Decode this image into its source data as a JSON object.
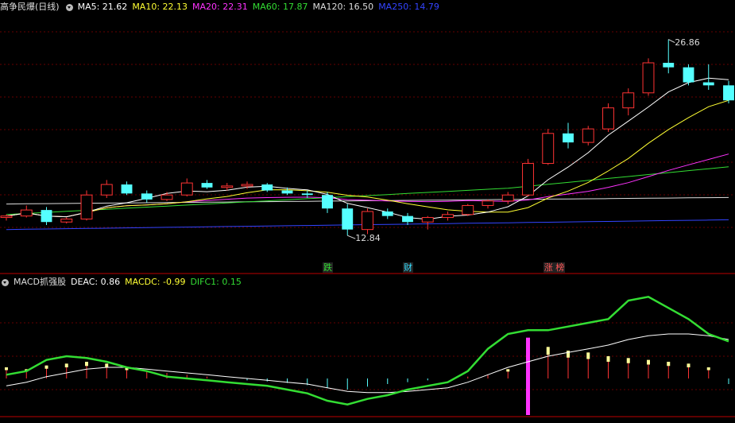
{
  "main_legend": {
    "title": "高争民爆(日线)",
    "items": [
      {
        "text": "MA5: 21.62",
        "color": "#ffffff"
      },
      {
        "text": "MA10: 22.13",
        "color": "#ffff33"
      },
      {
        "text": "MA20: 22.31",
        "color": "#ff33ff"
      },
      {
        "text": "MA60: 17.87",
        "color": "#33dd33"
      },
      {
        "text": "MA120: 16.50",
        "color": "#dddddd"
      },
      {
        "text": "MA250: 14.79",
        "color": "#3344ff"
      }
    ]
  },
  "sub_legend": {
    "title": "MACD抓强股",
    "items": [
      {
        "text": "DEAC: 0.86",
        "color": "#ffffff"
      },
      {
        "text": "MACDC: -0.99",
        "color": "#ffff33"
      },
      {
        "text": "DIFC1: 0.15",
        "color": "#33dd33"
      }
    ]
  },
  "annotations": {
    "high": "26.86",
    "low": "12.84"
  },
  "tags": [
    {
      "text": "跌",
      "color": "#33dd33",
      "index": 16
    },
    {
      "text": "财",
      "color": "#33ddff",
      "index": 20
    },
    {
      "text": "涨 榜",
      "color": "#ff5555",
      "index": 27
    }
  ],
  "colors": {
    "up": "#ff3333",
    "down": "#55ffff",
    "grid": "#660000",
    "border": "#bb0000"
  },
  "chart_data": {
    "type": "candlestick",
    "price_range": [
      11.8,
      28.0
    ],
    "candles": [
      [
        15.0,
        15.2,
        14.8,
        15.1
      ],
      [
        15.1,
        15.8,
        15.0,
        15.5
      ],
      [
        15.5,
        15.7,
        14.5,
        14.7
      ],
      [
        14.7,
        15.0,
        14.6,
        14.9
      ],
      [
        14.9,
        16.8,
        14.8,
        16.5
      ],
      [
        16.5,
        17.5,
        16.3,
        17.2
      ],
      [
        17.2,
        17.4,
        16.5,
        16.6
      ],
      [
        16.6,
        16.8,
        16.0,
        16.2
      ],
      [
        16.2,
        16.7,
        16.1,
        16.5
      ],
      [
        16.5,
        17.6,
        16.4,
        17.3
      ],
      [
        17.3,
        17.5,
        16.9,
        17.0
      ],
      [
        17.0,
        17.3,
        16.8,
        17.1
      ],
      [
        17.1,
        17.4,
        16.9,
        17.2
      ],
      [
        17.2,
        17.3,
        16.7,
        16.8
      ],
      [
        16.8,
        17.0,
        16.5,
        16.6
      ],
      [
        16.6,
        16.8,
        16.3,
        16.5
      ],
      [
        16.5,
        16.7,
        15.3,
        15.6
      ],
      [
        15.6,
        15.9,
        13.8,
        14.2
      ],
      [
        14.2,
        15.6,
        13.9,
        15.4
      ],
      [
        15.4,
        15.6,
        14.9,
        15.1
      ],
      [
        15.1,
        15.3,
        14.5,
        14.7
      ],
      [
        14.7,
        15.1,
        14.2,
        15.0
      ],
      [
        15.0,
        15.4,
        14.8,
        15.2
      ],
      [
        15.2,
        15.9,
        15.1,
        15.8
      ],
      [
        15.8,
        16.2,
        15.6,
        16.1
      ],
      [
        16.1,
        16.7,
        15.9,
        16.5
      ],
      [
        16.5,
        18.9,
        16.4,
        18.6
      ],
      [
        18.6,
        20.9,
        18.5,
        20.6
      ],
      [
        20.6,
        21.3,
        19.6,
        20.0
      ],
      [
        20.0,
        21.1,
        19.8,
        20.9
      ],
      [
        20.9,
        22.6,
        20.7,
        22.3
      ],
      [
        22.3,
        23.6,
        21.8,
        23.3
      ],
      [
        23.3,
        25.6,
        23.1,
        25.3
      ],
      [
        25.3,
        26.86,
        24.6,
        25.0
      ],
      [
        25.0,
        25.2,
        23.8,
        24.0
      ],
      [
        24.0,
        25.2,
        23.5,
        23.8
      ],
      [
        23.8,
        24.1,
        22.6,
        22.8
      ]
    ],
    "macd": {
      "histogram": [
        0.3,
        0.25,
        0.35,
        0.4,
        0.45,
        0.4,
        0.3,
        0.2,
        0.15,
        0.1,
        0.05,
        0.0,
        -0.05,
        -0.08,
        -0.12,
        -0.18,
        -0.25,
        -0.3,
        -0.22,
        -0.15,
        -0.1,
        -0.05,
        0.0,
        0.05,
        0.1,
        0.25,
        0.6,
        0.85,
        0.75,
        0.7,
        0.6,
        0.55,
        0.5,
        0.45,
        0.4,
        0.3,
        -0.15
      ],
      "dif": [
        0.1,
        0.2,
        0.5,
        0.6,
        0.55,
        0.45,
        0.3,
        0.2,
        0.05,
        0.0,
        -0.05,
        -0.1,
        -0.15,
        -0.2,
        -0.3,
        -0.4,
        -0.6,
        -0.7,
        -0.55,
        -0.45,
        -0.3,
        -0.2,
        -0.1,
        0.2,
        0.8,
        1.2,
        1.3,
        1.3,
        1.4,
        1.5,
        1.6,
        2.1,
        2.2,
        1.9,
        1.6,
        1.2,
        1.0
      ],
      "dea": [
        -0.2,
        -0.1,
        0.05,
        0.15,
        0.25,
        0.3,
        0.3,
        0.25,
        0.2,
        0.15,
        0.1,
        0.05,
        0.0,
        -0.05,
        -0.1,
        -0.15,
        -0.25,
        -0.35,
        -0.38,
        -0.38,
        -0.35,
        -0.3,
        -0.25,
        -0.1,
        0.1,
        0.3,
        0.45,
        0.6,
        0.7,
        0.8,
        0.9,
        1.05,
        1.15,
        1.2,
        1.2,
        1.15,
        1.05
      ]
    }
  }
}
